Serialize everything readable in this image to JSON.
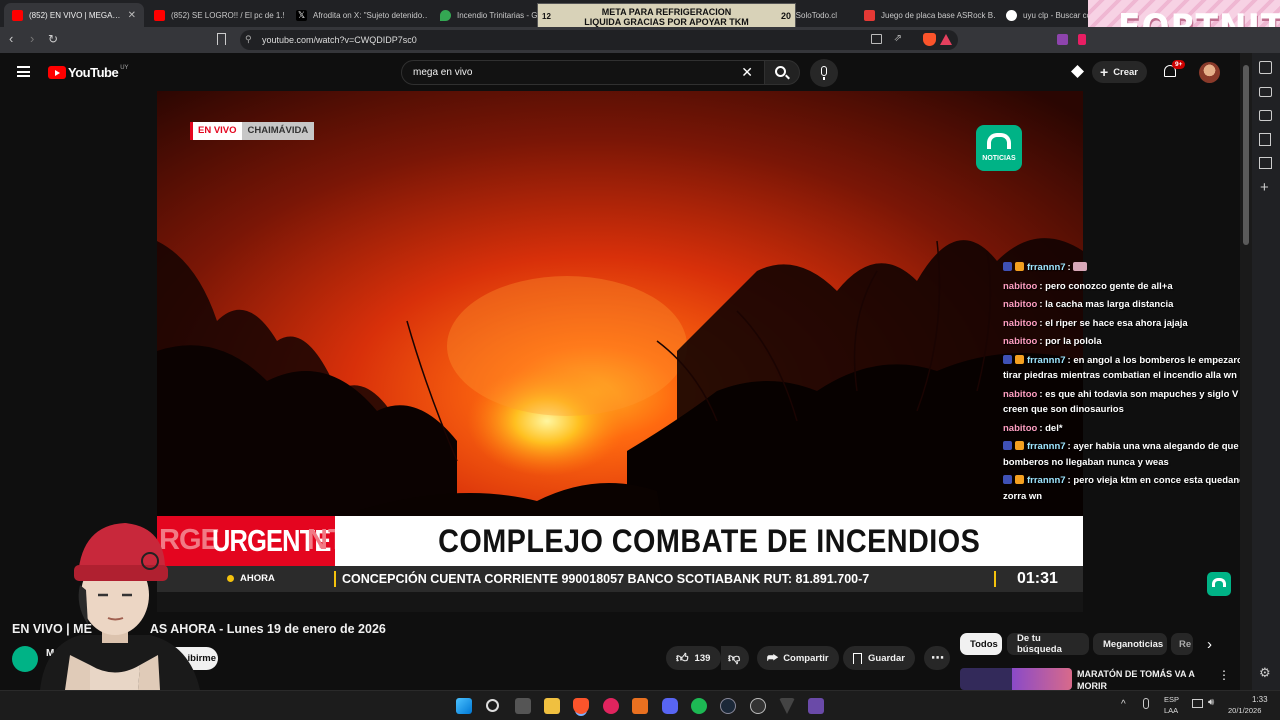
{
  "browser": {
    "tabs": [
      {
        "title": "(852) EN VIVO | MEGA…",
        "favicon_color": "#ff0000",
        "active": true
      },
      {
        "title": "(852) SE LOGRO!! / El pc de 1.5…",
        "favicon_color": "#ff0000",
        "active": false
      },
      {
        "title": "Afrodita on X: \"Sujeto detenido…",
        "favicon_color": "#ffffff",
        "active": false
      },
      {
        "title": "Incendio Trinitarias - Go…",
        "favicon_color": "#34a853",
        "active": false
      },
      {
        "title": "ny3 | Búsqueda… SoloTodo.cl",
        "favicon_color": "#4285f4",
        "active": false
      },
      {
        "title": "Juego de placa base ASRock B…",
        "favicon_color": "#e53935",
        "active": false
      },
      {
        "title": "uyu clp - Buscar co…",
        "favicon_color": "#4285f4",
        "active": false
      }
    ],
    "url": "youtube.com/watch?v=CWQDIDP7sc0"
  },
  "overlays": {
    "meta_left": "12",
    "meta_line1": "META PARA REFRIGERACION",
    "meta_line2": "LIQUIDA GRACIAS POR APOYAR TKM",
    "meta_right": "20",
    "fortnite": "FORTNITE"
  },
  "youtube": {
    "logo": "YouTube",
    "region": "UY",
    "search_value": "mega en vivo",
    "create_label": "Crear",
    "notif_badge": "9+"
  },
  "video": {
    "live_label": "EN VIVO",
    "location": "CHAIMÁVIDA",
    "channel_logo_text": "NOTICIAS",
    "urgent_label": "URGENTE",
    "urgent_ghost_left": "RGE",
    "urgent_ghost_right": "NT",
    "headline": "COMPLEJO COMBATE DE INCENDIOS",
    "ahora_label": "AHORA",
    "ticker": "CONCEPCIÓN CUENTA CORRIENTE 990018057 BANCO SCOTIABANK RUT: 81.891.700-7",
    "clock": "01:31"
  },
  "chat": [
    {
      "user": "frrannn7",
      "text": "",
      "user_color": "#9fe6ff",
      "badges": true
    },
    {
      "user": "nabitoo",
      "text": "pero conozco gente de all+a",
      "user_color": "#ff9ec0",
      "badges": false
    },
    {
      "user": "nabitoo",
      "text": "la cacha mas larga distancia",
      "user_color": "#ff9ec0",
      "badges": false
    },
    {
      "user": "nabitoo",
      "text": "el riper se hace esa ahora jajaja",
      "user_color": "#ff9ec0",
      "badges": false
    },
    {
      "user": "nabitoo",
      "text": "por la polola",
      "user_color": "#ff9ec0",
      "badges": false
    },
    {
      "user": "frrannn7",
      "text": "en angol a los bomberos le empezaron a tirar piedras mientras combatian el incendio alla wn",
      "user_color": "#9fe6ff",
      "badges": true
    },
    {
      "user": "nabitoo",
      "text": "es que ahi todavia son mapuches y siglo V y creen que son dinosaurios",
      "user_color": "#ff9ec0",
      "badges": false
    },
    {
      "user": "nabitoo",
      "text": "del*",
      "user_color": "#ff9ec0",
      "badges": false
    },
    {
      "user": "frrannn7",
      "text": "ayer habia una wna alegando de que los bomberos no llegaban nunca y weas",
      "user_color": "#9fe6ff",
      "badges": true
    },
    {
      "user": "frrannn7",
      "text": "pero vieja ktm en conce esta quedando la zorra wn",
      "user_color": "#9fe6ff",
      "badges": true
    }
  ],
  "below": {
    "title_start": "EN VIVO | ME",
    "title_end": "AS AHORA - Lunes 19 de enero de 2026",
    "channel_prefix": "M",
    "subscribe": "…ibirme",
    "likes": "139",
    "share": "Compartir",
    "save": "Guardar",
    "more": "⋯",
    "chips": [
      "Todos",
      "De tu búsqueda",
      "Meganoticias",
      "Re"
    ],
    "rec_title": "MARATÓN DE TOMÁS VA A MORIR"
  },
  "taskbar": {
    "lang1": "ESP",
    "lang2": "LAA",
    "time": "1:33",
    "date": "20/1/2026"
  },
  "colors": {
    "yt_red": "#ff0000",
    "mega_green": "#00b386",
    "urgent_red": "#e4051f",
    "ticker_yellow": "#f4c20d"
  }
}
